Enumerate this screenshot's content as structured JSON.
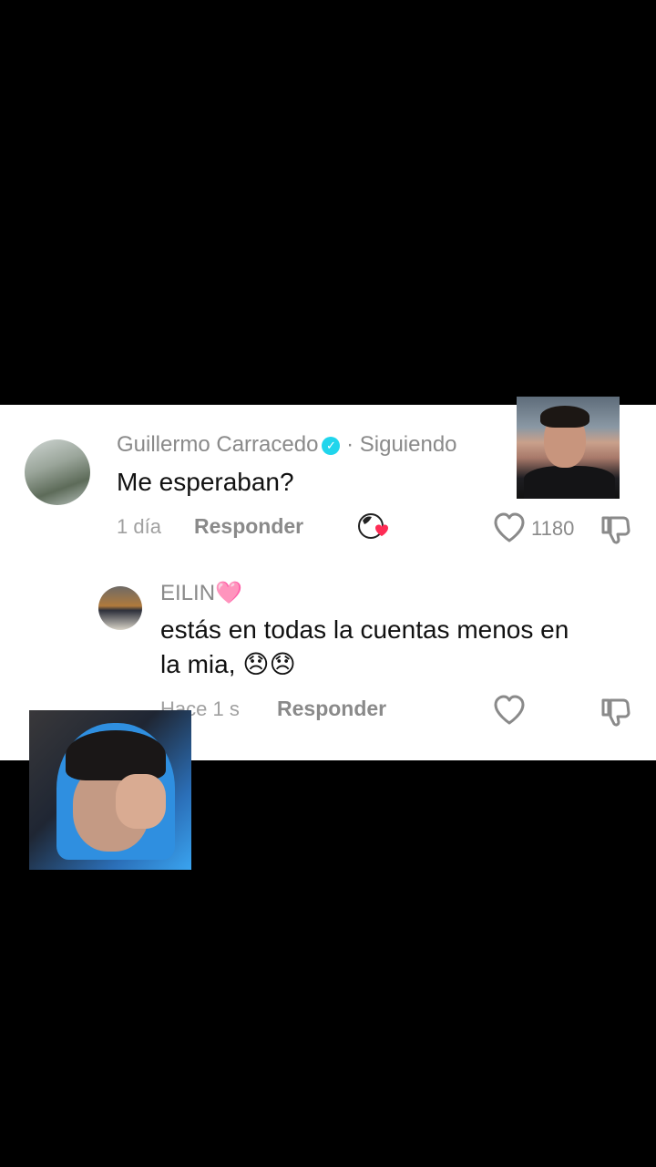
{
  "comment": {
    "username": "Guillermo Carracedo",
    "following_label": "· Siguiendo",
    "text": "Me esperaban?",
    "time": "1 día",
    "reply_label": "Responder",
    "likes": "1180",
    "avatar_icon": "user-avatar",
    "verified_icon": "verified-badge",
    "creator_liked_icon": "creator-liked-heart"
  },
  "reply": {
    "username": "EILIN🩷",
    "text_line1": "estás en todas la cuentas menos en",
    "text_line2": "la mia, 😞😞",
    "time": "Hace 1 s",
    "reply_label": "Responder"
  },
  "colors": {
    "verified": "#20d5ec",
    "muted": "#8a8a8a",
    "text": "#111111"
  }
}
